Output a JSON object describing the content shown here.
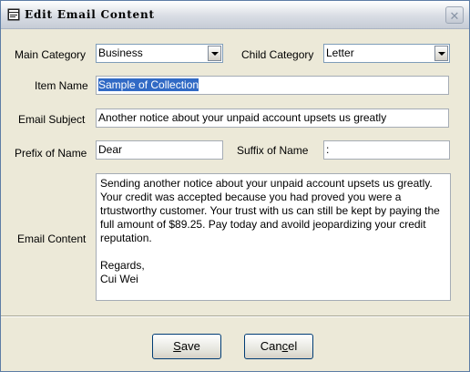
{
  "window": {
    "title": "Edit Email Content",
    "close_label": "✕"
  },
  "form": {
    "main_category": {
      "label": "Main Category",
      "value": "Business"
    },
    "child_category": {
      "label": "Child Category",
      "value": "Letter"
    },
    "item_name": {
      "label": "Item Name",
      "value": "Sample of Collection"
    },
    "email_subject": {
      "label": "Email Subject",
      "value": "Another notice about your unpaid account upsets us greatly"
    },
    "prefix_of_name": {
      "label": "Prefix of Name",
      "value": "Dear"
    },
    "suffix_of_name": {
      "label": "Suffix of Name",
      "value": ":"
    },
    "email_content": {
      "label": "Email Content",
      "value": "Sending another notice about your unpaid account upsets us greatly. Your credit was accepted because you had proved you were a trtustworthy customer. Your trust with us can still be kept by paying the full amount of $89.25. Pay today and avoild jeopardizing your credit reputation.\n\nRegards,\nCui Wei"
    }
  },
  "buttons": {
    "save": {
      "label": "Save",
      "mnemonic": "S",
      "rest": "ave"
    },
    "cancel": {
      "label": "Cancel",
      "pre": "Can",
      "mnemonic": "c",
      "rest": "el"
    }
  },
  "icons": {
    "app": "app-window-icon",
    "dropdown": "chevron-down-icon",
    "close": "close-icon"
  }
}
